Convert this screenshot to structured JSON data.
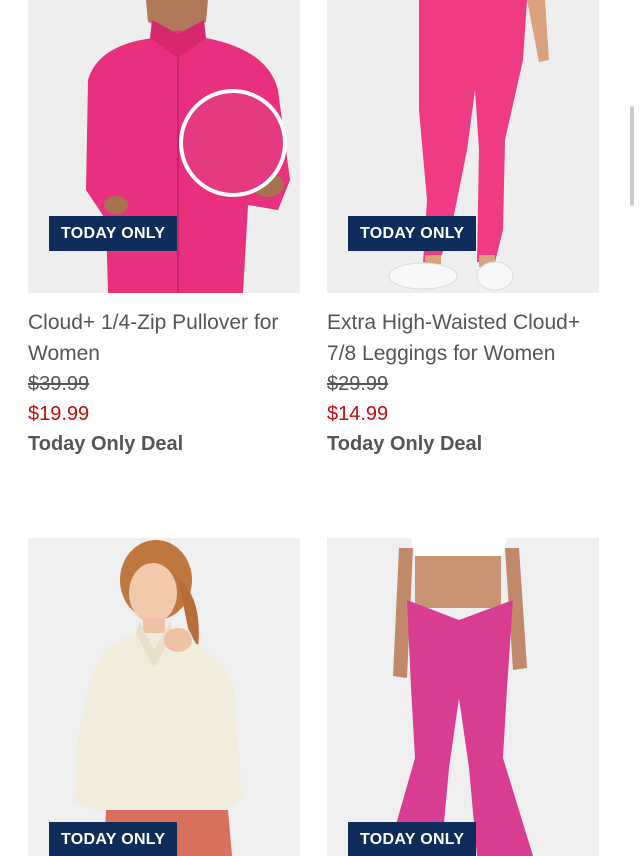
{
  "products": [
    {
      "badge": "TODAY ONLY",
      "title": "Cloud+ 1/4-Zip Pullover for Women",
      "price_original": "$39.99",
      "price_sale": "$19.99",
      "deal_label": "Today Only Deal",
      "colors": {
        "garment": "#e8307e",
        "background": "#eeeeee"
      }
    },
    {
      "badge": "TODAY ONLY",
      "title": "Extra High-Waisted Cloud+ 7/8 Leggings for Women",
      "price_original": "$29.99",
      "price_sale": "$14.99",
      "deal_label": "Today Only Deal",
      "colors": {
        "garment": "#ef3a84",
        "background": "#eeeeee"
      }
    },
    {
      "badge": "TODAY ONLY",
      "colors": {
        "garment": "#f2ecdc",
        "background": "#efefef"
      }
    },
    {
      "badge": "TODAY ONLY",
      "colors": {
        "garment": "#d83d92",
        "background": "#efefef"
      }
    }
  ],
  "theme": {
    "badge_bg": "#0f2d5a",
    "sale_color": "#c00d0d"
  }
}
